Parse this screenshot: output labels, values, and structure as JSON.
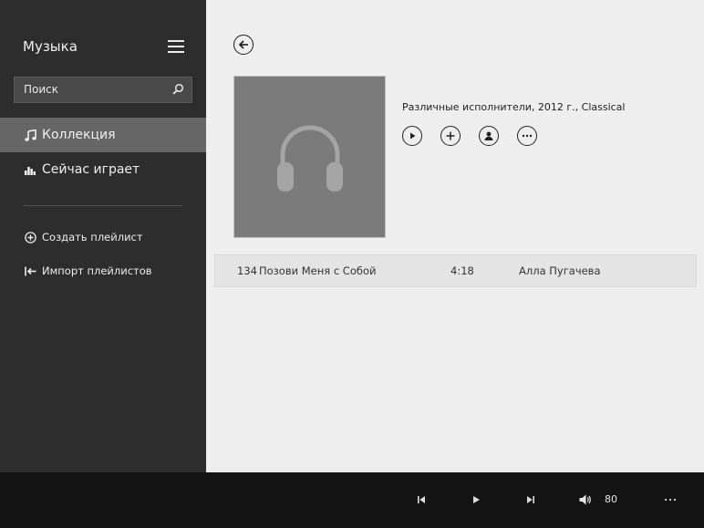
{
  "sidebar": {
    "app_title": "Музыка",
    "search": {
      "placeholder": "Поиск"
    },
    "nav": [
      {
        "label": "Коллекция",
        "icon": "music-note-icon",
        "active": true
      },
      {
        "label": "Сейчас играет",
        "icon": "equalizer-icon",
        "active": false
      }
    ],
    "actions": [
      {
        "label": "Создать плейлист",
        "icon": "plus-circle-icon"
      },
      {
        "label": "Импорт плейлистов",
        "icon": "import-icon"
      }
    ]
  },
  "album": {
    "info": "Различные исполнители, 2012 г., Classical",
    "art_icon": "headphones-icon",
    "buttons": [
      "play-icon",
      "plus-icon",
      "person-icon",
      "more-icon"
    ]
  },
  "tracks": [
    {
      "number": "134",
      "title": "Позови Меня с Собой",
      "duration": "4:18",
      "artist": "Алла Пугачева"
    }
  ],
  "player": {
    "volume": "80",
    "icons": [
      "previous-icon",
      "play-icon",
      "next-icon",
      "volume-icon",
      "more-icon"
    ]
  },
  "colors": {
    "sidebar_bg": "#2d2d2d",
    "active_nav": "#666666",
    "content_bg": "#eeeeee",
    "player_bg": "#141414"
  }
}
